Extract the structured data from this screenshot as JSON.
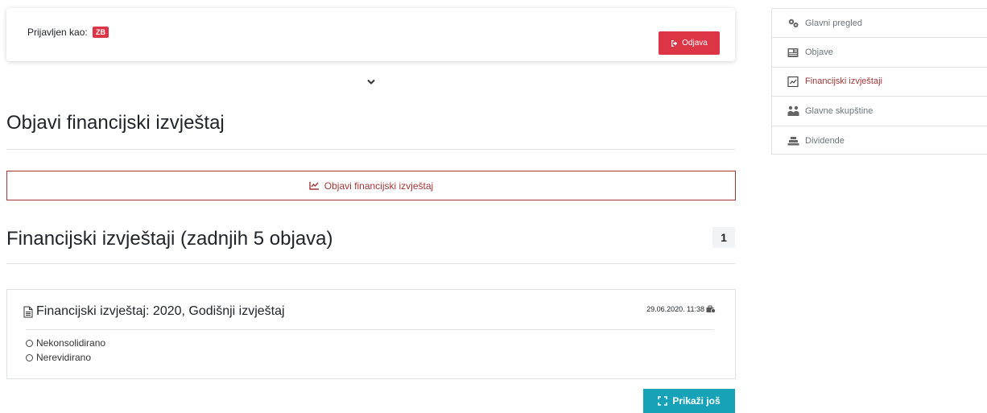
{
  "header": {
    "logged_in_label": "Prijavljen kao:",
    "user_badge": "ZB",
    "logout_label": "Odjava"
  },
  "publish": {
    "title": "Objavi financijski izvještaj",
    "button_label": "Objavi financijski izvještaj"
  },
  "reports": {
    "title": "Financijski izvještaji (zadnjih 5 objava)",
    "count": "1",
    "items": [
      {
        "title": "Financijski izvještaj: 2020, Godišnji izvještaj",
        "date": "29.06.2020. 11:38",
        "statuses": [
          "Nekonsolidirano",
          "Nerevidirano"
        ]
      }
    ],
    "more_label": "Prikaži još"
  },
  "sidebar": {
    "items": [
      {
        "label": "Glavni pregled",
        "icon": "cogs-icon",
        "active": false
      },
      {
        "label": "Objave",
        "icon": "newspaper-icon",
        "active": false
      },
      {
        "label": "Financijski izvještaji",
        "icon": "chart-square-icon",
        "active": true
      },
      {
        "label": "Glavne skupštine",
        "icon": "people-icon",
        "active": false
      },
      {
        "label": "Dividende",
        "icon": "money-stack-icon",
        "active": false
      }
    ]
  },
  "colors": {
    "danger": "#dc3545",
    "dark_red": "#a33636",
    "info": "#17a2b8"
  }
}
